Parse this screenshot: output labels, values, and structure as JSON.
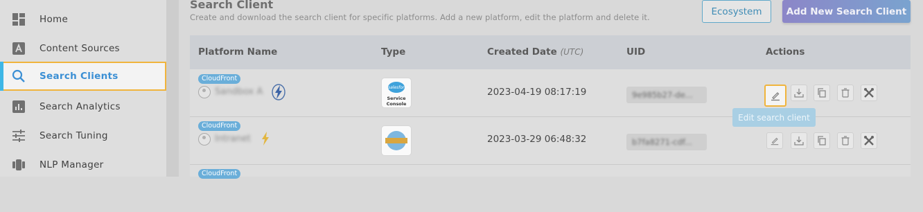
{
  "sidebar": {
    "items": [
      {
        "label": "Home",
        "icon": "dashboard-icon"
      },
      {
        "label": "Content Sources",
        "icon": "content-sources-icon"
      },
      {
        "label": "Search Clients",
        "icon": "search-icon"
      },
      {
        "label": "Search Analytics",
        "icon": "analytics-icon"
      },
      {
        "label": "Search Tuning",
        "icon": "sliders-icon"
      },
      {
        "label": "NLP Manager",
        "icon": "nlp-icon"
      }
    ],
    "active_index": 2
  },
  "header": {
    "title": "Search Client",
    "subtitle": "Create and download the search client for specific platforms. Add a new platform, edit the platform and delete it.",
    "ecosystem_label": "Ecosystem",
    "add_label": "Add New Search Client"
  },
  "table": {
    "columns": {
      "platform": "Platform Name",
      "type": "Type",
      "created": "Created Date",
      "created_unit": "(UTC)",
      "uid": "UID",
      "actions": "Actions"
    },
    "rows": [
      {
        "badge": "CloudFront",
        "name": "Sandbox A",
        "type_logo": "salesforce",
        "type_caption_1": "Service",
        "type_caption_2": "Console",
        "type_brand": "salesforce",
        "created": "2023-04-19 08:17:19",
        "uid": "9e985b27-de..."
      },
      {
        "badge": "CloudFront",
        "name": "Intranet",
        "type_logo": "globe",
        "created": "2023-03-29 06:48:32",
        "uid": "b7fa8271-cdf..."
      },
      {
        "badge": "CloudFront"
      }
    ]
  },
  "tooltip": "Edit search client",
  "colors": {
    "accent": "#3fb7e6",
    "highlight": "#f0b43c",
    "badge": "#6aaed9"
  }
}
